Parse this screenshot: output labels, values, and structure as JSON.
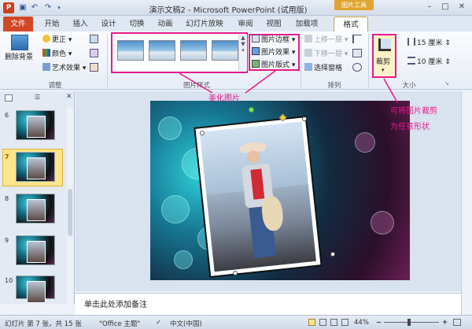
{
  "title_bar": {
    "app_title": "演示文稿2 - Microsoft PowerPoint (试用版)",
    "contextual_tab": "图片工具",
    "app_icon": "P",
    "window_buttons": [
      "minimize",
      "maximize",
      "close"
    ]
  },
  "tabs": [
    "文件",
    "开始",
    "插入",
    "设计",
    "切换",
    "动画",
    "幻灯片放映",
    "审阅",
    "视图",
    "加载项",
    "格式"
  ],
  "ribbon": {
    "adjust": {
      "remove_bg": "删除背景",
      "corrections": "更正",
      "color": "颜色",
      "art_effects": "艺术效果",
      "group_label": "调整"
    },
    "picture_styles": {
      "border": "图片边框",
      "effects": "图片效果",
      "layout": "图片版式",
      "group_label": "图片样式"
    },
    "arrange": {
      "bring_forward": "上移一层",
      "send_backward": "下移一层",
      "selection_pane": "选择窗格",
      "group_label": "排列"
    },
    "size": {
      "crop": "裁剪",
      "height": "15 厘米",
      "width": "10 厘米",
      "group_label": "大小"
    }
  },
  "slides_pane": {
    "slide_numbers": [
      "6",
      "7",
      "8",
      "9",
      "10"
    ],
    "selected": "7"
  },
  "annotations": {
    "beautify": "美化图片",
    "crop_hint_line1": "可将图片裁剪",
    "crop_hint_line2": "为任意形状"
  },
  "notes_placeholder": "单击此处添加备注",
  "status_bar": {
    "slide_info": "幻灯片 第 7 张，共 15 张",
    "theme": "\"Office 主题\"",
    "language": "中文(中国)",
    "zoom": "44%"
  },
  "colors": {
    "accent_pink": "#e61a8c",
    "file_tab": "#d24726",
    "contextual": "#e0a531"
  }
}
